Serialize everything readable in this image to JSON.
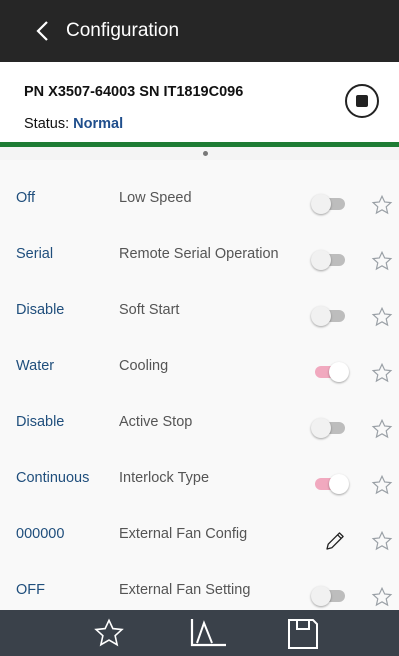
{
  "app": {
    "title": "Configuration"
  },
  "device": {
    "pn_sn": "PN X3507-64003 SN IT1819C096",
    "status_label": "Status: ",
    "status_value": "Normal"
  },
  "colors": {
    "topbar": "#262626",
    "status_value": "#1f4e8c",
    "accent_line": "#1e7c34",
    "toggle_on": "#f1a9bf",
    "bottombar": "#3a414a"
  },
  "settings": [
    {
      "value": "Off",
      "label": "Low Speed",
      "control": "toggle",
      "on": false
    },
    {
      "value": "Serial",
      "label": "Remote Serial Operation",
      "control": "toggle",
      "on": false
    },
    {
      "value": "Disable",
      "label": "Soft Start",
      "control": "toggle",
      "on": false
    },
    {
      "value": "Water",
      "label": "Cooling",
      "control": "toggle",
      "on": true
    },
    {
      "value": "Disable",
      "label": "Active Stop",
      "control": "toggle",
      "on": false
    },
    {
      "value": "Continuous",
      "label": "Interlock Type",
      "control": "toggle",
      "on": true
    },
    {
      "value": "000000",
      "label": "External Fan Config",
      "control": "edit",
      "on": false
    },
    {
      "value": "OFF",
      "label": "External Fan Setting",
      "control": "toggle",
      "on": false
    }
  ],
  "bottom_nav": [
    "star-icon",
    "chart-icon",
    "save-icon"
  ]
}
